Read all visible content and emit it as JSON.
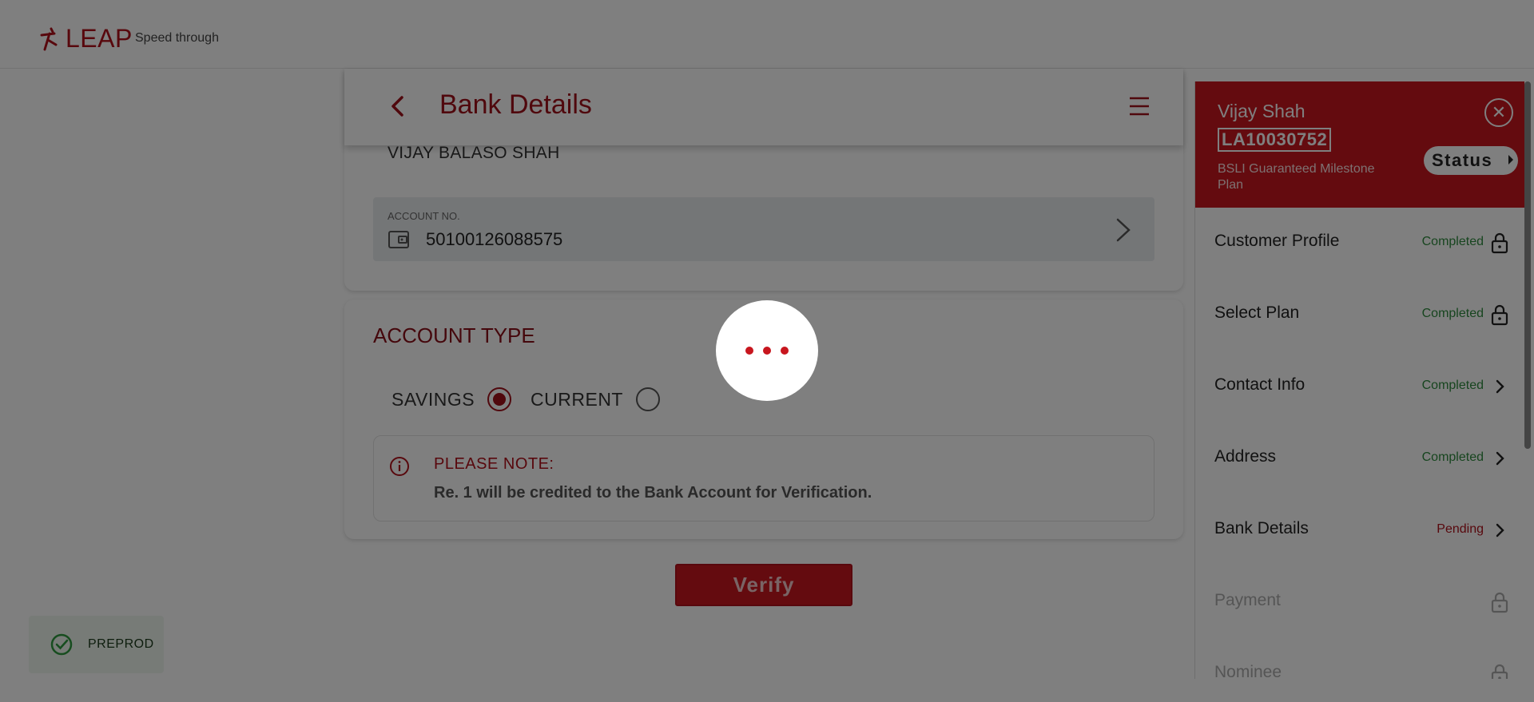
{
  "header": {
    "logo_text": "LEAP",
    "tagline": "Speed through"
  },
  "page": {
    "title": "Bank Details"
  },
  "account_holder": "VIJAY BALASO SHAH",
  "account": {
    "label": "ACCOUNT NO.",
    "number": "50100126088575"
  },
  "account_type": {
    "title": "ACCOUNT TYPE",
    "options": [
      {
        "label": "SAVINGS",
        "selected": true
      },
      {
        "label": "CURRENT",
        "selected": false
      }
    ]
  },
  "note": {
    "title": "PLEASE NOTE:",
    "text": "Re. 1 will be credited to the Bank Account for Verification."
  },
  "verify_label": "Verify",
  "environment": "PREPROD",
  "sidebar": {
    "customer_name": "Vijay Shah",
    "policy_number": "LA10030752",
    "plan_name": "BSLI Guaranteed Milestone Plan",
    "status_label": "Status",
    "steps": [
      {
        "label": "Customer Profile",
        "status": "Completed",
        "icon": "lock-icon"
      },
      {
        "label": "Select Plan",
        "status": "Completed",
        "icon": "lock-icon"
      },
      {
        "label": "Contact Info",
        "status": "Completed",
        "icon": "chevron-right-icon"
      },
      {
        "label": "Address",
        "status": "Completed",
        "icon": "chevron-right-icon"
      },
      {
        "label": "Bank Details",
        "status": "Pending",
        "icon": "chevron-right-icon"
      },
      {
        "label": "Payment",
        "status": "",
        "icon": "lock-icon"
      },
      {
        "label": "Nominee",
        "status": "",
        "icon": "lock-icon"
      }
    ]
  },
  "colors": {
    "brand_red": "#c8161e",
    "completed_green": "#2e8b3e",
    "overlay": "rgba(0,0,0,0.5)"
  }
}
